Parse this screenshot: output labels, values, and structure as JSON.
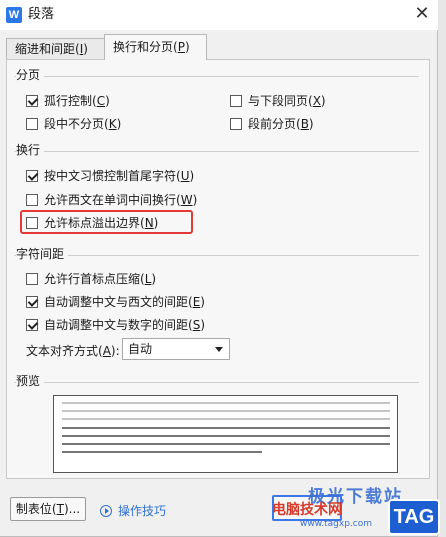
{
  "window": {
    "title": "段落",
    "app_icon": "W",
    "close_glyph": "✕"
  },
  "tabs": [
    {
      "label": "缩进和间距(",
      "key": "I",
      "suffix": ")"
    },
    {
      "label": "换行和分页(",
      "key": "P",
      "suffix": ")"
    }
  ],
  "pagination": {
    "title": "分页",
    "options": [
      {
        "label": "孤行控制(",
        "key": "C",
        "suffix": ")",
        "checked": true
      },
      {
        "label": "与下段同页(",
        "key": "X",
        "suffix": ")",
        "checked": false
      },
      {
        "label": "段中不分页(",
        "key": "K",
        "suffix": ")",
        "checked": false
      },
      {
        "label": "段前分页(",
        "key": "B",
        "suffix": ")",
        "checked": false
      }
    ]
  },
  "line_break": {
    "title": "换行",
    "options": [
      {
        "label": "按中文习惯控制首尾字符(",
        "key": "U",
        "suffix": ")",
        "checked": true
      },
      {
        "label": "允许西文在单词中间换行(",
        "key": "W",
        "suffix": ")",
        "checked": false
      },
      {
        "label": "允许标点溢出边界(",
        "key": "N",
        "suffix": ")",
        "checked": false
      }
    ]
  },
  "char_spacing": {
    "title": "字符间距",
    "options": [
      {
        "label": "允许行首标点压缩(",
        "key": "L",
        "suffix": ")",
        "checked": false
      },
      {
        "label": "自动调整中文与西文的间距(",
        "key": "E",
        "suffix": ")",
        "checked": true
      },
      {
        "label": "自动调整中文与数字的间距(",
        "key": "S",
        "suffix": ")",
        "checked": true
      }
    ],
    "align_label": "文本对齐方式(",
    "align_key": "A",
    "align_suffix": "):",
    "align_value": "自动"
  },
  "preview": {
    "title": "预览"
  },
  "footer": {
    "tabs_button": "制表位(",
    "tabs_key": "T",
    "tabs_suffix": ")...",
    "tips_link": "操作技巧"
  },
  "watermark": {
    "line1": "极光下载站",
    "line2": "电脑技术网",
    "url": "www.tagxp.com",
    "tag": "TAG"
  },
  "colors": {
    "highlight": "#e53935",
    "link": "#2f6fd8",
    "tag_bg": "#1d5fd1"
  }
}
